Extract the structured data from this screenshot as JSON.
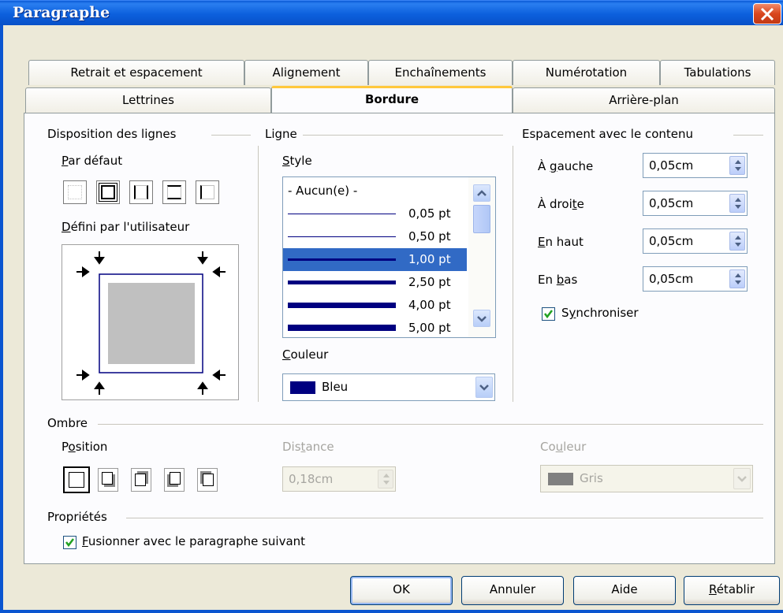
{
  "window": {
    "title": "Paragraphe"
  },
  "tabs_row1": [
    "Retrait et espacement",
    "Alignement",
    "Enchaînements",
    "Numérotation",
    "Tabulations"
  ],
  "tabs_row2": [
    "Lettrines",
    "Bordure",
    "Arrière-plan"
  ],
  "active_tab": "Bordure",
  "line_arrangement": {
    "title": "Disposition des lignes",
    "default_label": "Par défaut",
    "user_defined_label": "Défini par l'utilisateur",
    "default_presets": [
      "none",
      "box",
      "left-right",
      "top-bottom",
      "left"
    ]
  },
  "line": {
    "title": "Ligne",
    "style_label": "Style",
    "styles": [
      "- Aucun(e) -",
      "0,05 pt",
      "0,50 pt",
      "1,00 pt",
      "2,50 pt",
      "4,00 pt",
      "5,00 pt"
    ],
    "selected_style": "1,00 pt",
    "color_label": "Couleur",
    "color_value": "Bleu",
    "color_swatch": "#000080"
  },
  "spacing": {
    "title": "Espacement avec le contenu",
    "left_label": "À gauche",
    "left_value": "0,05cm",
    "right_label": "À droite",
    "right_value": "0,05cm",
    "top_label": "En haut",
    "top_value": "0,05cm",
    "bottom_label": "En bas",
    "bottom_value": "0,05cm",
    "sync_label": "Synchroniser",
    "sync_checked": true
  },
  "shadow": {
    "title": "Ombre",
    "position_label": "Position",
    "distance_label": "Distance",
    "distance_value": "0,18cm",
    "color_label": "Couleur",
    "color_value": "Gris",
    "color_swatch": "#808080"
  },
  "properties": {
    "title": "Propriétés",
    "merge_label": "Fusionner avec le paragraphe suivant",
    "merge_checked": true
  },
  "buttons": {
    "ok": "OK",
    "cancel": "Annuler",
    "help": "Aide",
    "reset": "Rétablir"
  },
  "colors": {
    "titlebar": "#0c60dd",
    "selection": "#316ac5",
    "active_tab_accent": "#ffc83c"
  }
}
